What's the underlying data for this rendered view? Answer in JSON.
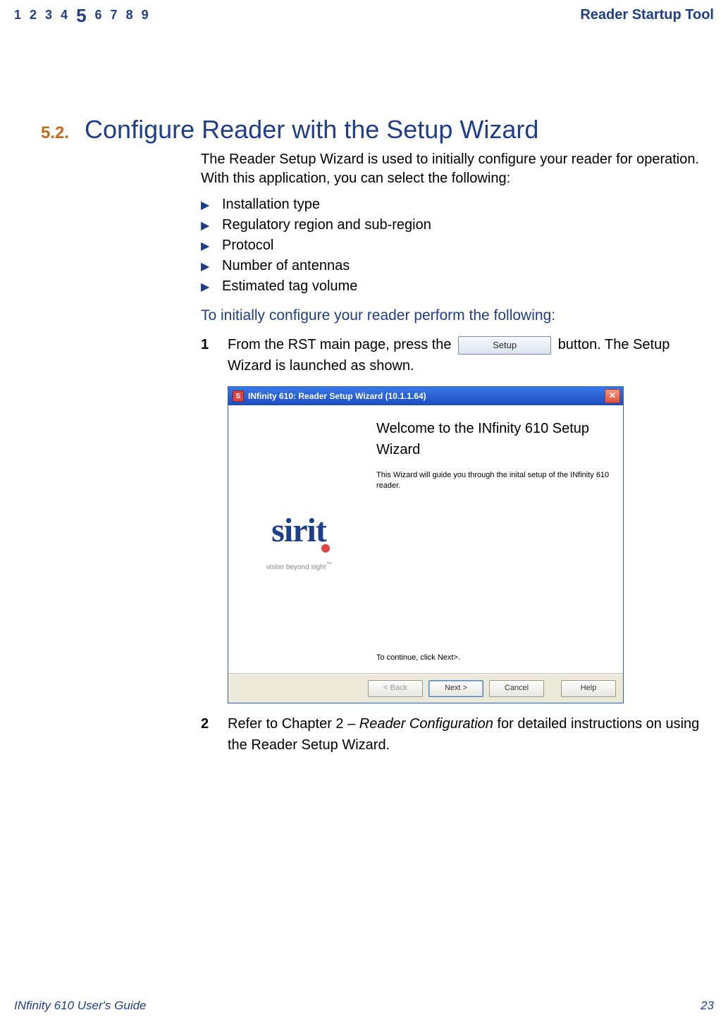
{
  "header": {
    "nav": [
      "1",
      "2",
      "3",
      "4",
      "5",
      "6",
      "7",
      "8",
      "9"
    ],
    "current": "5",
    "right": "Reader Startup Tool"
  },
  "section": {
    "num": "5.2.",
    "title": "Configure Reader with the Setup Wizard"
  },
  "intro": "The Reader Setup Wizard is used to initially configure your reader for operation. With this application, you can select the following:",
  "bullets": [
    "Installation type",
    "Regulatory region and sub-region",
    "Protocol",
    "Number of antennas",
    "Estimated tag volume"
  ],
  "sub_heading": "To initially configure your reader perform the following:",
  "step1": {
    "num": "1",
    "before": "From the RST main page, press the",
    "button": "Setup",
    "after": "button. The Setup Wizard is launched as shown."
  },
  "wizard": {
    "title": "INfinity 610: Reader Setup Wizard (10.1.1.64)",
    "welcome": "Welcome to the INfinity 610 Setup Wizard",
    "desc": "This Wizard will guide you through the inital setup of the INfinity 610 reader.",
    "continue": "To continue, click Next>.",
    "logo_tag": "vision beyond sight",
    "buttons": {
      "back": "< Back",
      "next": "Next >",
      "cancel": "Cancel",
      "help": "Help"
    }
  },
  "step2": {
    "num": "2",
    "before": "Refer to Chapter 2 – ",
    "link": "Reader Configuration",
    "after": " for detailed instructions on using the Reader Setup Wizard."
  },
  "footer": {
    "left_pre": "IN",
    "left_post": " 610 User's Guide",
    "page": "23"
  }
}
